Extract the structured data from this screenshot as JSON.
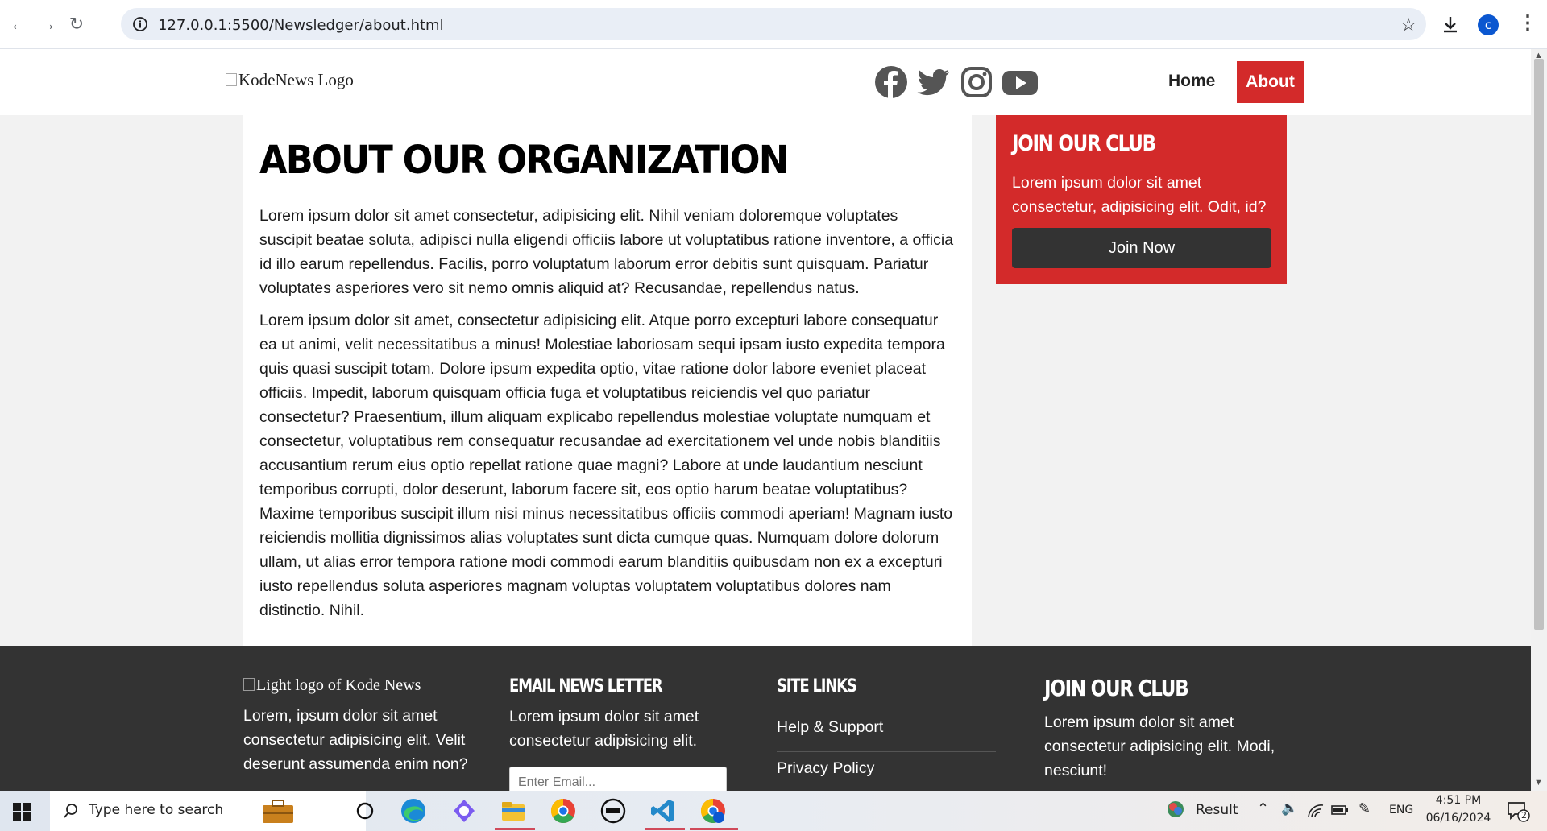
{
  "browser": {
    "url": "127.0.0.1:5500/Newsledger/about.html",
    "profile_initial": "c"
  },
  "header": {
    "logo_alt": "KodeNews Logo",
    "nav": {
      "home": "Home",
      "about": "About"
    },
    "social_icons": [
      "facebook-icon",
      "twitter-icon",
      "instagram-icon",
      "youtube-icon"
    ]
  },
  "article": {
    "title": "ABOUT OUR ORGANIZATION",
    "paragraphs": [
      "Lorem ipsum dolor sit amet consectetur, adipisicing elit. Nihil veniam doloremque voluptates suscipit beatae soluta, adipisci nulla eligendi officiis labore ut voluptatibus ratione inventore, a officia id illo earum repellendus. Facilis, porro voluptatum laborum error debitis sunt quisquam. Pariatur voluptates asperiores vero sit nemo omnis aliquid at? Recusandae, repellendus natus.",
      "Lorem ipsum dolor sit amet, consectetur adipisicing elit. Atque porro excepturi labore consequatur ea ut animi, velit necessitatibus a minus! Molestiae laboriosam sequi ipsam iusto expedita tempora quis quasi suscipit totam. Dolore ipsum expedita optio, vitae ratione dolor labore eveniet placeat officiis. Impedit, laborum quisquam officia fuga et voluptatibus reiciendis vel quo pariatur consectetur? Praesentium, illum aliquam explicabo repellendus molestiae voluptate numquam et consectetur, voluptatibus rem consequatur recusandae ad exercitationem vel unde nobis blanditiis accusantium rerum eius optio repellat ratione quae magni? Labore at unde laudantium nesciunt temporibus corrupti, dolor deserunt, laborum facere sit, eos optio harum beatae voluptatibus? Maxime temporibus suscipit illum nisi minus necessitatibus officiis commodi aperiam! Magnam iusto reiciendis mollitia dignissimos alias voluptates sunt dicta cumque quas. Numquam dolore dolorum ullam, ut alias error tempora ratione modi commodi earum blanditiis quibusdam non ex a excepturi iusto repellendus soluta asperiores magnam voluptas voluptatem voluptatibus dolores nam distinctio. Nihil."
    ]
  },
  "sidebar": {
    "title": "JOIN OUR CLUB",
    "text": "Lorem ipsum dolor sit amet consectetur, adipisicing elit. Odit, id?",
    "button": "Join Now"
  },
  "footer": {
    "logo_alt": "Light logo of Kode News",
    "about_text": "Lorem, ipsum dolor sit amet consectetur adipisicing elit. Velit deserunt assumenda enim non?",
    "newsletter": {
      "title": "EMAIL NEWS LETTER",
      "text": "Lorem ipsum dolor sit amet consectetur adipisicing elit.",
      "placeholder": "Enter Email..."
    },
    "links": {
      "title": "SITE LINKS",
      "items": [
        "Help & Support",
        "Privacy Policy"
      ]
    },
    "club": {
      "title": "JOIN OUR CLUB",
      "text": "Lorem ipsum dolor sit amet consectetur adipisicing elit. Modi, nesciunt!"
    }
  },
  "taskbar": {
    "search_placeholder": "Type here to search",
    "tray_label": "Result",
    "language": "ENG",
    "time": "4:51 PM",
    "date": "06/16/2024",
    "notification_count": "2"
  },
  "colors": {
    "accent": "#d32a2a",
    "footer_bg": "#333333",
    "button_dark": "#333333"
  }
}
